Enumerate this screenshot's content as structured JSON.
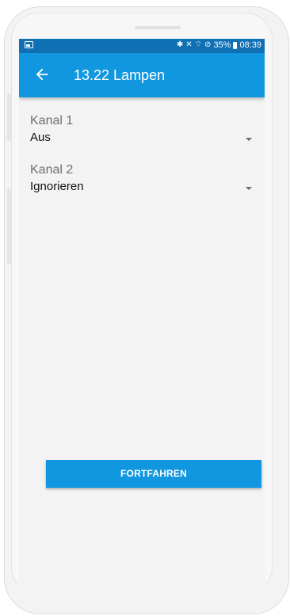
{
  "status_bar": {
    "bluetooth_icon": "bluetooth-icon",
    "mute_icon": "vibrate-mute-icon",
    "wifi_icon": "wifi-icon",
    "dnd_icon": "do-not-disturb-icon",
    "battery_percent": "35%",
    "time": "08:39"
  },
  "app_bar": {
    "title": "13.22 Lampen",
    "back_icon": "arrow-left-icon",
    "color": "#1197e0"
  },
  "fields": [
    {
      "label": "Kanal 1",
      "value": "Aus"
    },
    {
      "label": "Kanal 2",
      "value": "Ignorieren"
    }
  ],
  "actions": {
    "continue_label": "FORTFAHREN"
  },
  "colors": {
    "statusbar": "#0f70b4",
    "primary": "#1197e0",
    "background": "#f3f3f3"
  }
}
